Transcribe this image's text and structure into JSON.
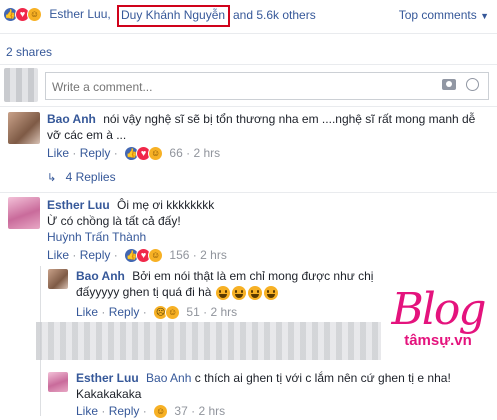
{
  "summary": {
    "names_1": "Esther Luu,",
    "names_2": "Duy Khánh Nguyễn",
    "names_3": "and 5.6k others",
    "sort_label": "Top comments"
  },
  "shares": "2 shares",
  "composer": {
    "placeholder": "Write a comment..."
  },
  "comments": {
    "c1": {
      "name": "Bao Anh",
      "text": "nói vậy nghệ sĩ sẽ bị tổn thương nha em ....nghệ sĩ rất mong manh dễ vỡ các em à ...",
      "like": "Like",
      "reply": "Reply",
      "count": "66",
      "time": "2 hrs",
      "replies_label": "4 Replies",
      "dot": "·"
    },
    "c2": {
      "name": "Esther Luu",
      "line1": "Ôi mẹ ơi kkkkkkkk",
      "line2": "Ừ có chồng là tất cả đấy!",
      "mention": "Huỳnh Trấn Thành",
      "like": "Like",
      "reply": "Reply",
      "count": "156",
      "time": "2 hrs"
    },
    "r1": {
      "name": "Bao Anh",
      "text": "Bởi em nói thật là em chỉ mong được như chị đấyyyyy ghen tị quá đi hà",
      "like": "Like",
      "reply": "Reply",
      "count": "51",
      "time": "2 hrs"
    },
    "r2": {
      "name": "Esther Luu",
      "mention": "Bao Anh",
      "text": "c thích ai ghen tị với c lắm nên cứ ghen tị e nha!",
      "line2": "Kakakakaka",
      "like": "Like",
      "reply": "Reply",
      "count": "37",
      "time": "2 hrs"
    }
  },
  "watermark": {
    "logo": "Blog",
    "sub": "tâmsự.vn"
  },
  "colors": {
    "link": "#365899",
    "highlight_box": "#d0021b",
    "watermark": "#e4137d"
  }
}
